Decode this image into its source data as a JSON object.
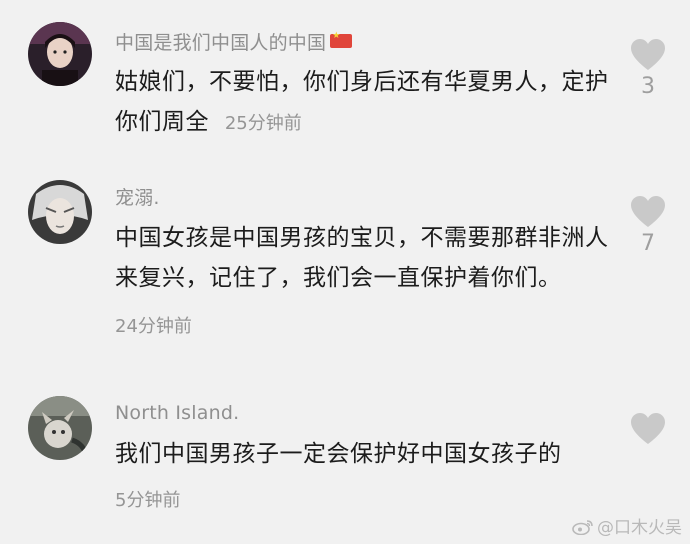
{
  "comments": [
    {
      "username": "中国是我们中国人的中国",
      "text_line1": "姑娘们，不要怕，你们身后还有华夏男人，定护",
      "text_line2": "你们周全",
      "time": "25分钟前",
      "likes": "3",
      "has_flag": true
    },
    {
      "username": "宠溺.",
      "text_line1": "中国女孩是中国男孩的宝贝，不需要那群非洲人",
      "text_line2": "来复兴，记住了，我们会一直保护着你们。",
      "time": "24分钟前",
      "likes": "7"
    },
    {
      "username": "North Island.",
      "text_line1": "我们中国男孩子一定会保护好中国女孩子的",
      "time": "5分钟前",
      "likes": ""
    }
  ],
  "watermark": {
    "text": "@口木火吴",
    "icon": "weibo-icon"
  },
  "colors": {
    "background": "#f1f1f1",
    "heart": "#c9c9c9",
    "flag": "#e0453a"
  }
}
